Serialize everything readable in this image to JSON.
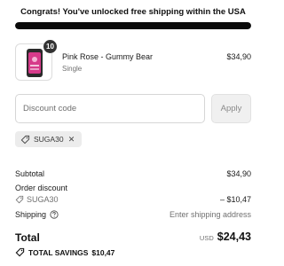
{
  "banner": {
    "text": "Congrats! You've unlocked free shipping within the USA",
    "progress_percent": 100
  },
  "cart_item": {
    "quantity": "10",
    "name": "Pink Rose - Gummy Bear",
    "variant": "Single",
    "price": "$34,90",
    "thumbnail_icon": "product-can-icon"
  },
  "discount": {
    "placeholder": "Discount code",
    "value": "",
    "apply_label": "Apply",
    "applied_code": "SUGA30"
  },
  "summary": {
    "subtotal_label": "Subtotal",
    "subtotal_value": "$34,90",
    "order_discount_label": "Order discount",
    "discount_code": "SUGA30",
    "discount_value": "– $10,47",
    "shipping_label": "Shipping",
    "shipping_value": "Enter shipping address",
    "total_label": "Total",
    "currency": "USD",
    "total_value": "$24,43",
    "savings_label": "TOTAL SAVINGS",
    "savings_value": "$10,47"
  },
  "colors": {
    "accent": "#0a0a0a",
    "muted_text": "#707070",
    "product_pink": "#d63a8a"
  }
}
